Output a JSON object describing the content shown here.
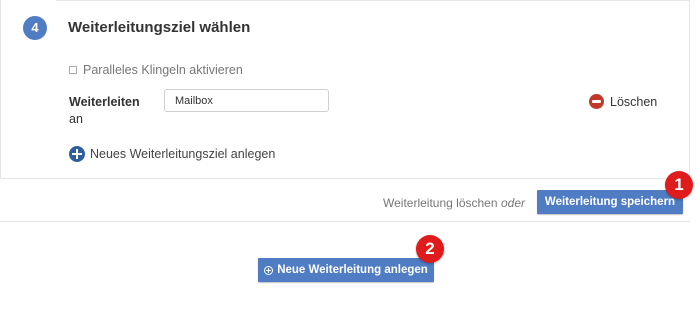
{
  "section": {
    "step_number": "4",
    "title": "Weiterleitungsziel wählen",
    "parallel_ring_label": "Paralleles Klingeln aktivieren",
    "parallel_ring_checked": false,
    "forward_label_main": "Weiterleiten",
    "forward_label_sub": "an",
    "target_value": "Mailbox",
    "delete_label": "Löschen",
    "add_target_label": "Neues Weiterleitungsziel anlegen"
  },
  "footer": {
    "delete_forward_label": "Weiterleitung löschen",
    "or_label": "oder",
    "save_label": "Weiterleitung speichern"
  },
  "new_forward_label": "Neue Weiterleitung anlegen",
  "markers": [
    "1",
    "2"
  ],
  "colors": {
    "primary": "#4f7cc3",
    "step_circle": "#4f7cc3",
    "delete_icon": "#c0392b",
    "add_icon": "#2f5d9e",
    "marker": "#e01b1b"
  },
  "icons": {
    "delete": "minus-circle-icon",
    "add": "plus-circle-icon"
  }
}
